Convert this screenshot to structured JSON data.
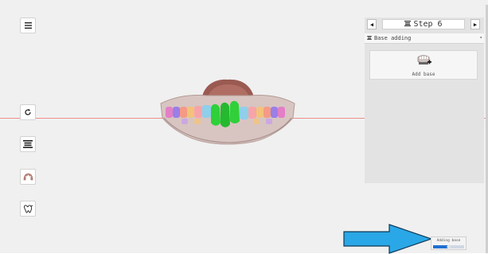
{
  "toolbar": {
    "items": [
      {
        "name": "menu-icon"
      },
      {
        "name": "reset-view-icon"
      },
      {
        "name": "layers-icon"
      },
      {
        "name": "arch-view-icon"
      },
      {
        "name": "tooth-icon"
      }
    ]
  },
  "panel": {
    "step_label": "Step 6",
    "step_select": "Base adding",
    "add_base_label": "Add base"
  },
  "status": {
    "progress_label": "Adding base",
    "progress_percent": "46%",
    "progress_fraction": 0.46
  },
  "colors": {
    "viewport_bg": "#f0f0f0",
    "panel_bg": "#e3e3e3",
    "guide_line": "#f08c8c",
    "callout_arrow": "#2aa7e6",
    "selected_teeth": "#2fd03a",
    "progress_fill": "#1f6fd1"
  }
}
